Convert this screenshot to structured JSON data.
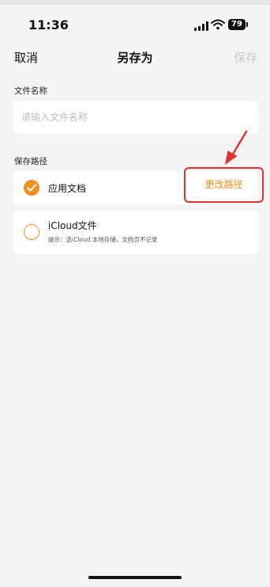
{
  "status_bar": {
    "time": "11:36",
    "battery": "79"
  },
  "navbar": {
    "cancel": "取消",
    "title": "另存为",
    "save": "保存"
  },
  "file_name": {
    "label": "文件名称",
    "placeholder": "请输入文件名称"
  },
  "save_path": {
    "label": "保存路径",
    "options": [
      {
        "label": "应用文档",
        "selected": true,
        "action": "更改路径"
      },
      {
        "label": "iCloud文件",
        "selected": false,
        "hint": "提示：选iCloud 本地存储，文档页不记录"
      }
    ]
  },
  "colors": {
    "accent": "#f0901e",
    "highlight": "#e53030",
    "disabled": "#c8c8c8"
  },
  "icons": [
    "signal-icon",
    "wifi-icon",
    "battery-icon",
    "checkmark-icon",
    "empty-radio-icon",
    "red-arrow-annotation"
  ]
}
